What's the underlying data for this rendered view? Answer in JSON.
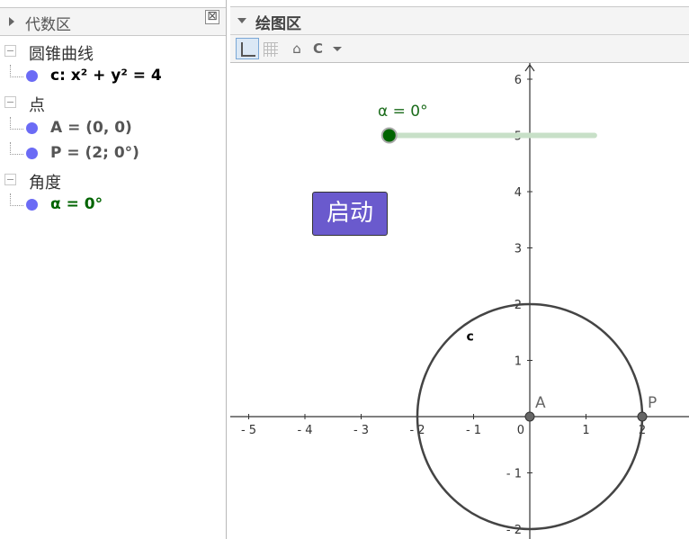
{
  "algebra": {
    "title": "代数区",
    "close_symbol": "⊠",
    "groups": [
      {
        "label": "圆锥曲线",
        "items": [
          {
            "text": "c: x² + y² = 4",
            "color": "#000000"
          }
        ]
      },
      {
        "label": "点",
        "items": [
          {
            "text": "A = (0, 0)",
            "color": "#555555"
          },
          {
            "text": "P = (2; 0°)",
            "color": "#555555"
          }
        ]
      },
      {
        "label": "角度",
        "items": [
          {
            "text": "α = 0°",
            "color": "#006400"
          }
        ]
      }
    ]
  },
  "graphics": {
    "title": "绘图区",
    "toolbar": {
      "home_symbol": "⌂",
      "style_symbol": "C"
    },
    "start_button": "启动",
    "slider_label": "α = 0°",
    "curve_label": "c",
    "point_labels": {
      "A": "A",
      "P": "P"
    },
    "x_ticks": [
      "- 5",
      "- 4",
      "- 3",
      "- 2",
      "- 1",
      "0",
      "1",
      "2"
    ],
    "y_ticks": [
      "6",
      "5",
      "4",
      "3",
      "2",
      "1",
      "- 1",
      "- 2"
    ],
    "x_tick_values": [
      -5,
      -4,
      -3,
      -2,
      -1,
      0,
      1,
      2
    ],
    "y_tick_values": [
      6,
      5,
      4,
      3,
      2,
      1,
      -1,
      -2
    ],
    "circle": {
      "cx": 0,
      "cy": 0,
      "r": 2
    },
    "slider": {
      "value_deg": 0,
      "y": 5,
      "x_start": -2.5,
      "x_end": 1.15
    },
    "colors": {
      "accent": "#6a5acd",
      "slider_track": "#c8e0c8",
      "slider_knob": "#006400",
      "point": "#666666"
    }
  }
}
